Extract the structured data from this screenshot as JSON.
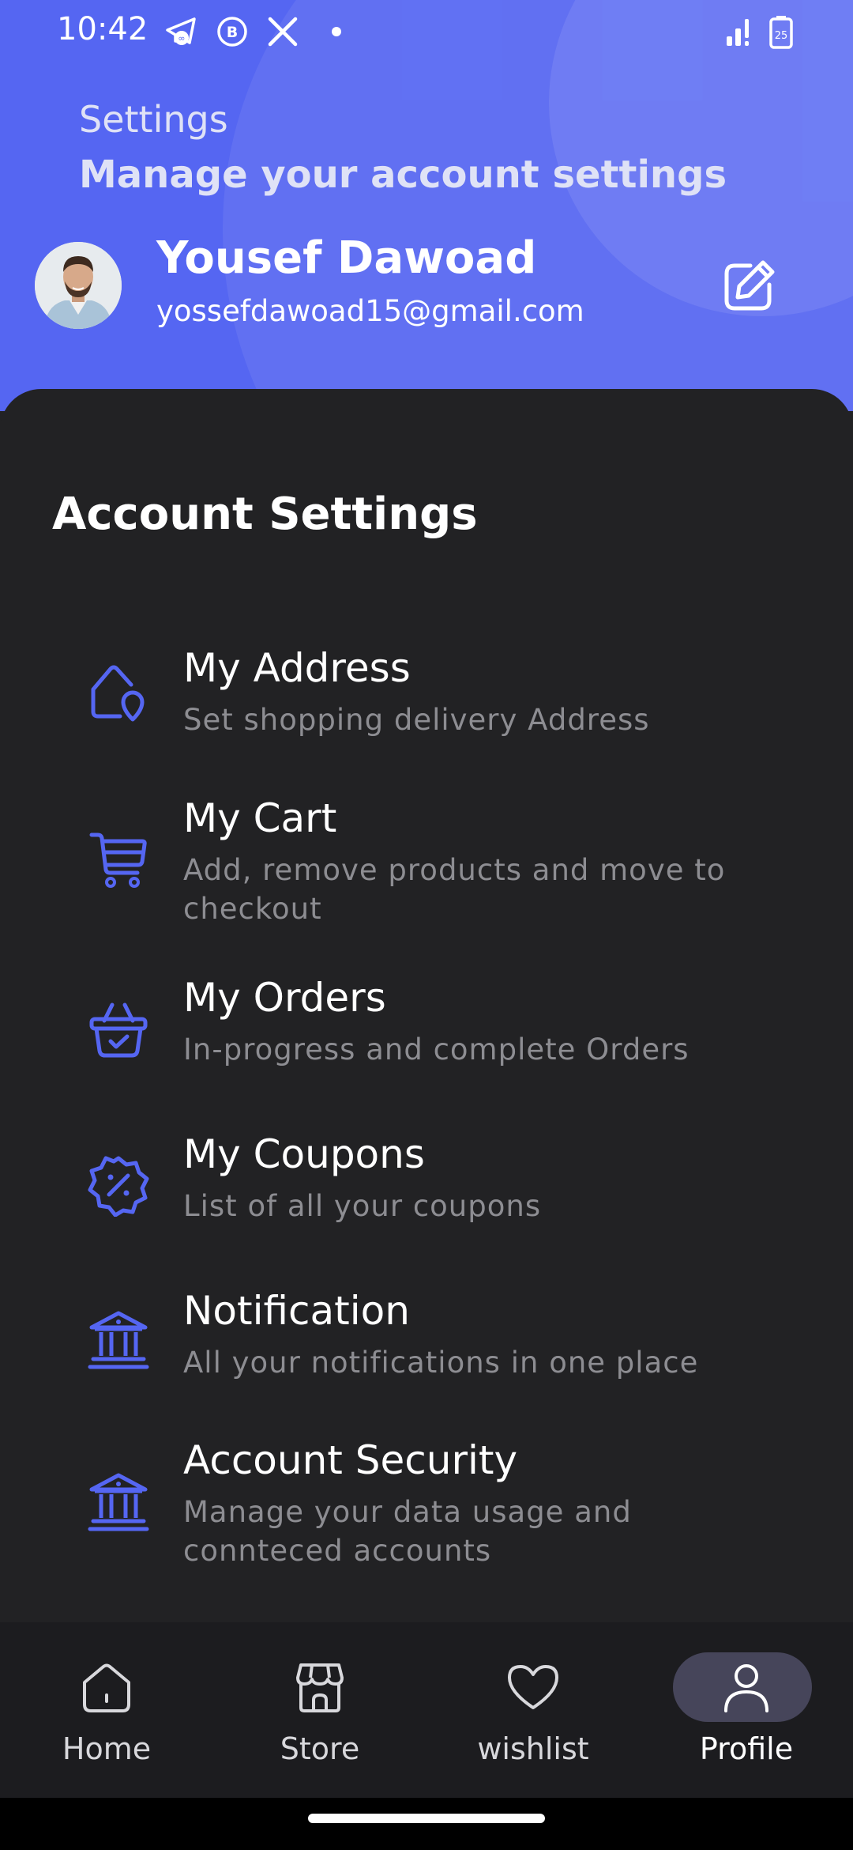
{
  "status_bar": {
    "time": "10:42",
    "battery": "25",
    "app_icons": [
      "telegram-icon",
      "whatsapp-business-icon",
      "x-icon",
      "dot-icon"
    ]
  },
  "header": {
    "title": "Settings",
    "subtitle": "Manage your account settings",
    "user_name": "Yousef Dawoad",
    "user_email": "yossefdawoad15@gmail.com"
  },
  "section_title": "Account Settings",
  "items": [
    {
      "title": "My Address",
      "desc": "Set shopping delivery Address",
      "icon": "house-pin-icon"
    },
    {
      "title": "My Cart",
      "desc": "Add, remove products and move to checkout",
      "icon": "cart-icon"
    },
    {
      "title": "My Orders",
      "desc": "In-progress and complete Orders",
      "icon": "basket-check-icon"
    },
    {
      "title": "My Coupons",
      "desc": "List of all your coupons",
      "icon": "discount-badge-icon"
    },
    {
      "title": "Notification",
      "desc": "All your notifications in one place",
      "icon": "bank-icon"
    },
    {
      "title": "Account Security",
      "desc": "Manage your data usage and connteced accounts",
      "icon": "bank-icon"
    }
  ],
  "nav": [
    {
      "label": "Home",
      "icon": "home-icon"
    },
    {
      "label": "Store",
      "icon": "store-icon"
    },
    {
      "label": "wishlist",
      "icon": "heart-icon"
    },
    {
      "label": "Profile",
      "icon": "user-icon"
    }
  ],
  "colors": {
    "header_bg": "#5566f2",
    "panel_bg": "#222224",
    "accent_icon": "#5566f2",
    "nav_bg": "#1c1c1f",
    "nav_active_pill": "#46455a"
  }
}
